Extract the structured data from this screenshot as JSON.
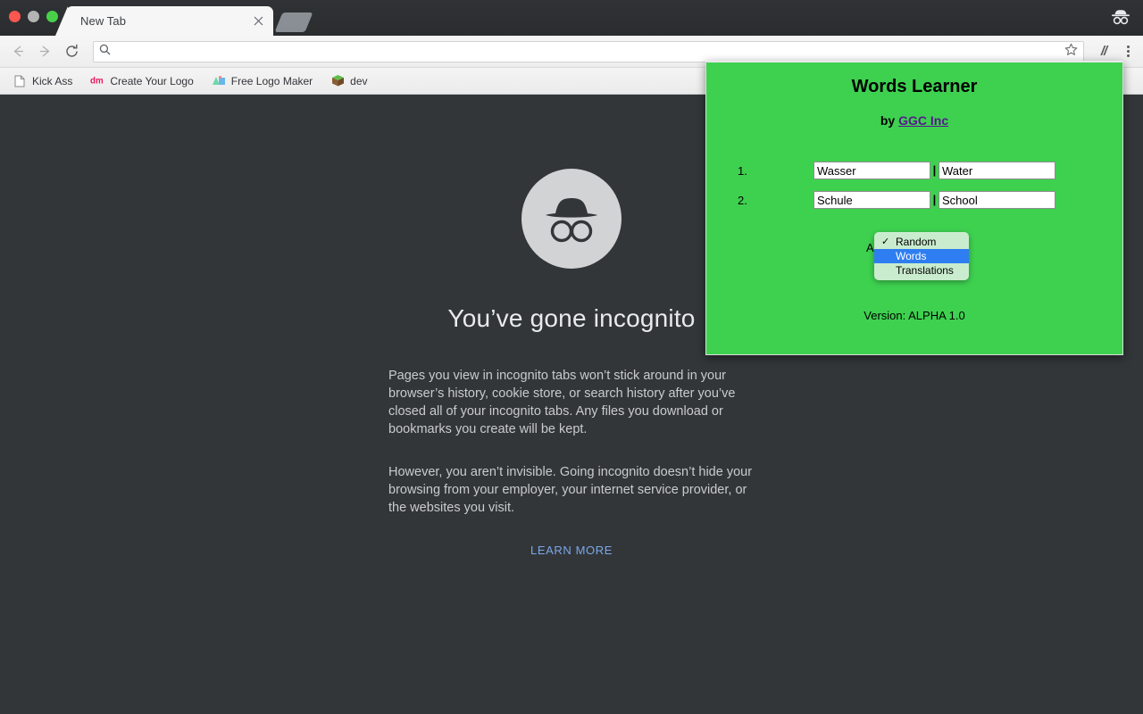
{
  "browser": {
    "window_controls": [
      "close",
      "minimize",
      "zoom"
    ],
    "tab": {
      "title": "New Tab",
      "close_icon": "close-icon"
    },
    "new_tab_button": "new-tab-button",
    "incognito_badge_icon": "incognito-icon",
    "toolbar": {
      "back_icon": "arrow-left-icon",
      "forward_icon": "arrow-right-icon",
      "reload_icon": "reload-icon",
      "omnibox": {
        "value": "",
        "placeholder": "",
        "search_icon": "search-icon",
        "bookmark_icon": "star-icon"
      },
      "extension_icon_label": "//",
      "menu_icon": "kebab-menu-icon"
    },
    "bookmarks": [
      {
        "label": "Kick Ass",
        "icon": "page-icon"
      },
      {
        "label": "Create Your Logo",
        "icon": "dm-logo-icon"
      },
      {
        "label": "Free Logo Maker",
        "icon": "shapes-icon"
      },
      {
        "label": "dev",
        "icon": "grass-block-icon"
      }
    ]
  },
  "ntp": {
    "icon": "incognito-spy-icon",
    "heading": "You’ve gone incognito",
    "paragraph1": "Pages you view in incognito tabs won’t stick around in your browser’s history, cookie store, or search history after you’ve closed all of your incognito tabs. Any files you download or bookmarks you create will be kept.",
    "paragraph2": "However, you aren’t invisible. Going incognito doesn’t hide your browsing from your employer, your internet service provider, or the websites you visit.",
    "learn_more": "LEARN MORE"
  },
  "popup": {
    "title": "Words Learner",
    "by_prefix": "by",
    "by_link": "GGC Inc",
    "rows": [
      {
        "num": "1.",
        "word": "Wasser",
        "separator": "|",
        "translation": "Water"
      },
      {
        "num": "2.",
        "word": "Schule",
        "separator": "|",
        "translation": "School"
      }
    ],
    "ask_label": "Ask",
    "dropdown": {
      "checked": "Random",
      "highlighted": "Words",
      "options": [
        {
          "label": "Random",
          "checked": true,
          "highlighted": false
        },
        {
          "label": "Words",
          "checked": false,
          "highlighted": true
        },
        {
          "label": "Translations",
          "checked": false,
          "highlighted": false
        }
      ]
    },
    "version": "Version: ALPHA 1.0",
    "colors": {
      "background": "#3ed150",
      "link": "#551a8b",
      "dropdown_bg": "#c9ecce",
      "dropdown_highlight": "#2f7ef1"
    }
  }
}
